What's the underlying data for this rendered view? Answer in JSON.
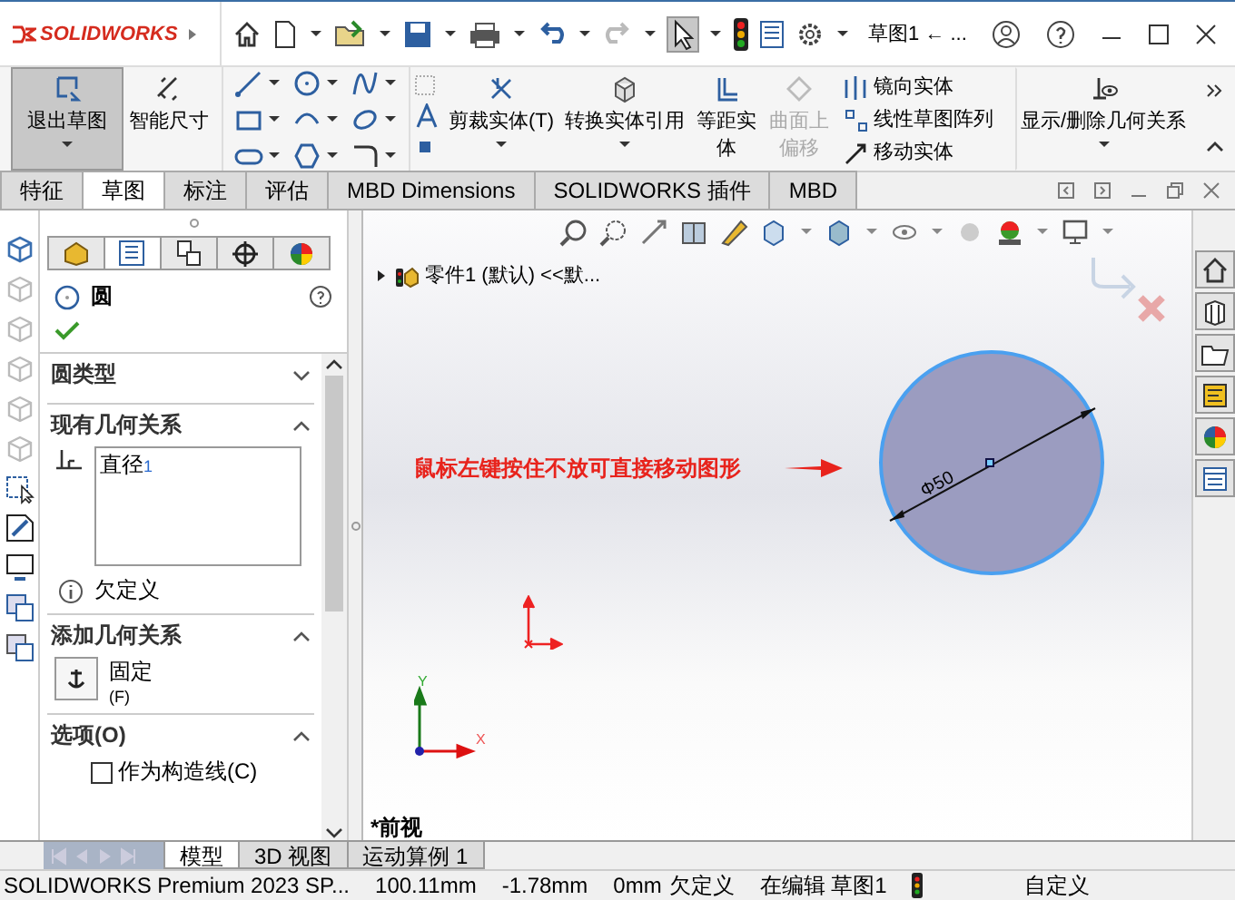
{
  "title_bar": {
    "logo": "SOLIDWORKS",
    "title": "草图1 ← ...",
    "select_tool": {
      "selected": true
    }
  },
  "ribbon": {
    "large_buttons": [
      {
        "label": "退出草图",
        "selected": true
      },
      {
        "label": "智能尺寸",
        "selected": false
      }
    ],
    "tools": [
      {
        "label": "剪裁实体(T)",
        "disabled": false
      },
      {
        "label": "转换实体引用",
        "disabled": false
      },
      {
        "label": "等距实体",
        "disabled": false
      },
      {
        "label": "曲面上偏移",
        "disabled": true
      }
    ],
    "small_tools": [
      "镜向实体",
      "线性草图阵列",
      "移动实体"
    ],
    "relations_button": "显示/删除几何关系"
  },
  "command_tabs": [
    {
      "label": "特征",
      "selected": false
    },
    {
      "label": "草图",
      "selected": true
    },
    {
      "label": "标注",
      "selected": false
    },
    {
      "label": "评估",
      "selected": false
    },
    {
      "label": "MBD Dimensions",
      "selected": false
    },
    {
      "label": "SOLIDWORKS 插件",
      "selected": false
    },
    {
      "label": "MBD",
      "selected": false
    }
  ],
  "panel_tabs": [
    {
      "selected": false
    },
    {
      "selected": true
    },
    {
      "selected": false
    },
    {
      "selected": false
    },
    {
      "selected": false
    }
  ],
  "property_manager": {
    "title": "圆",
    "circle_type": {
      "title": "圆类型",
      "expanded": false
    },
    "existing_relations": {
      "title": "现有几何关系",
      "expanded": true,
      "items": [
        "直径$_{1}$"
      ],
      "status": "欠定义"
    },
    "add_relations": {
      "title": "添加几何关系",
      "expanded": true,
      "items": [
        {
          "label": "固定",
          "shortcut": "(F)"
        }
      ]
    },
    "options": {
      "title": "选项(O)",
      "expanded": true,
      "items": [
        {
          "label": "作为构造线(C)",
          "checked": false
        }
      ]
    }
  },
  "canvas": {
    "tree": "零件1 (默认) <<默...",
    "annotation": "鼠标左键按住不放可直接移动图形",
    "dimension": "Φ50",
    "axes": {
      "x": "X",
      "y": "Y"
    },
    "view_name": "*前视"
  },
  "bottom_tabs": [
    {
      "label": "模型",
      "selected": true
    },
    {
      "label": "3D 视图",
      "selected": false
    },
    {
      "label": "运动算例 1",
      "selected": false
    }
  ],
  "status_bar": {
    "product": "SOLIDWORKS Premium 2023 SP...",
    "x": "100.11mm",
    "y": "-1.78mm",
    "z": "0mm",
    "state": "欠定义",
    "mode": "在编辑 草图1",
    "units": "自定义"
  }
}
